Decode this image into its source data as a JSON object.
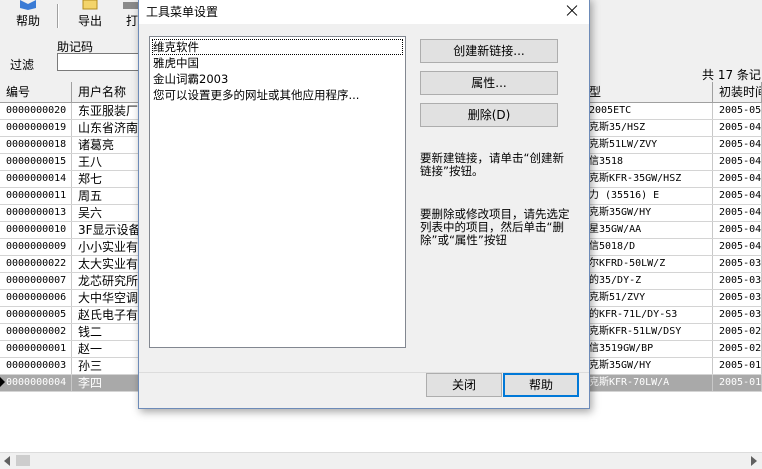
{
  "toolbar": {
    "items": [
      {
        "label": "帮助",
        "icon": "help-book-icon"
      },
      {
        "label": "导出",
        "icon": "export-icon"
      },
      {
        "label": "打",
        "icon": "print-icon"
      }
    ]
  },
  "filter": {
    "label": "过滤",
    "mnemonic_label": "助记码",
    "mnemonic_value": ""
  },
  "record_count": "共 17 条记",
  "grid": {
    "columns": [
      "编号",
      "用户名称",
      "型",
      "初装时间"
    ],
    "rows": [
      {
        "id": "0000000020",
        "name": "东亚服装厂",
        "model": "2005ETC",
        "date": "2005-05"
      },
      {
        "id": "0000000019",
        "name": "山东省济南市",
        "model": "克斯35/HSZ",
        "date": "2005-04"
      },
      {
        "id": "0000000018",
        "name": "诸葛亮",
        "model": "克斯51LW/ZVY",
        "date": "2005-04"
      },
      {
        "id": "0000000015",
        "name": "王八",
        "model": "信3518",
        "date": "2005-04"
      },
      {
        "id": "0000000014",
        "name": "郑七",
        "model": "克斯KFR-35GW/HSZ",
        "date": "2005-04"
      },
      {
        "id": "0000000011",
        "name": "周五",
        "model": "力 (35516) E",
        "date": "2005-04"
      },
      {
        "id": "0000000013",
        "name": "吴六",
        "model": "克斯35GW/HY",
        "date": "2005-04"
      },
      {
        "id": "0000000010",
        "name": "3F显示设备有",
        "model": "星35GW/AA",
        "date": "2005-04"
      },
      {
        "id": "0000000009",
        "name": "小小实业有限",
        "model": "信5018/D",
        "date": "2005-04"
      },
      {
        "id": "0000000022",
        "name": "太大实业有限",
        "model": "尔KFRD-50LW/Z",
        "date": "2005-03"
      },
      {
        "id": "0000000007",
        "name": "龙芯研究所",
        "model": "的35/DY-Z",
        "date": "2005-03"
      },
      {
        "id": "0000000006",
        "name": "大中华空调",
        "model": "克斯51/ZVY",
        "date": "2005-03"
      },
      {
        "id": "0000000005",
        "name": "赵氏电子有限",
        "model": "的KFR-71L/DY-S3",
        "date": "2005-03"
      },
      {
        "id": "0000000002",
        "name": "钱二",
        "model": "克斯KFR-51LW/DSY",
        "date": "2005-02"
      },
      {
        "id": "0000000001",
        "name": "赵一",
        "model": "信3519GW/BP",
        "date": "2005-02"
      },
      {
        "id": "0000000003",
        "name": "孙三",
        "model": "克斯35GW/HY",
        "date": "2005-01"
      },
      {
        "id": "0000000004",
        "name": "李四",
        "model": "克斯KFR-70LW/A",
        "date": "2005-01",
        "selected": true
      }
    ]
  },
  "dialog": {
    "title": "工具菜单设置",
    "links": [
      "维克软件",
      "雅虎中国",
      "金山词霸2003",
      "您可以设置更多的网址或其他应用程序..."
    ],
    "buttons": {
      "create": "创建新链接...",
      "properties": "属性...",
      "delete": "删除(D)",
      "close": "关闭",
      "help": "帮助"
    },
    "hint_create": "要新建链接，请单击“创建新链接”按钮。",
    "hint_edit": "要删除或修改项目，请先选定列表中的项目，然后单击“删除”或“属性”按钮"
  },
  "colors": {
    "dialog_border": "#6d8bb8",
    "default_button_border": "#0078d7",
    "selected_row": "#a9a9a9"
  }
}
